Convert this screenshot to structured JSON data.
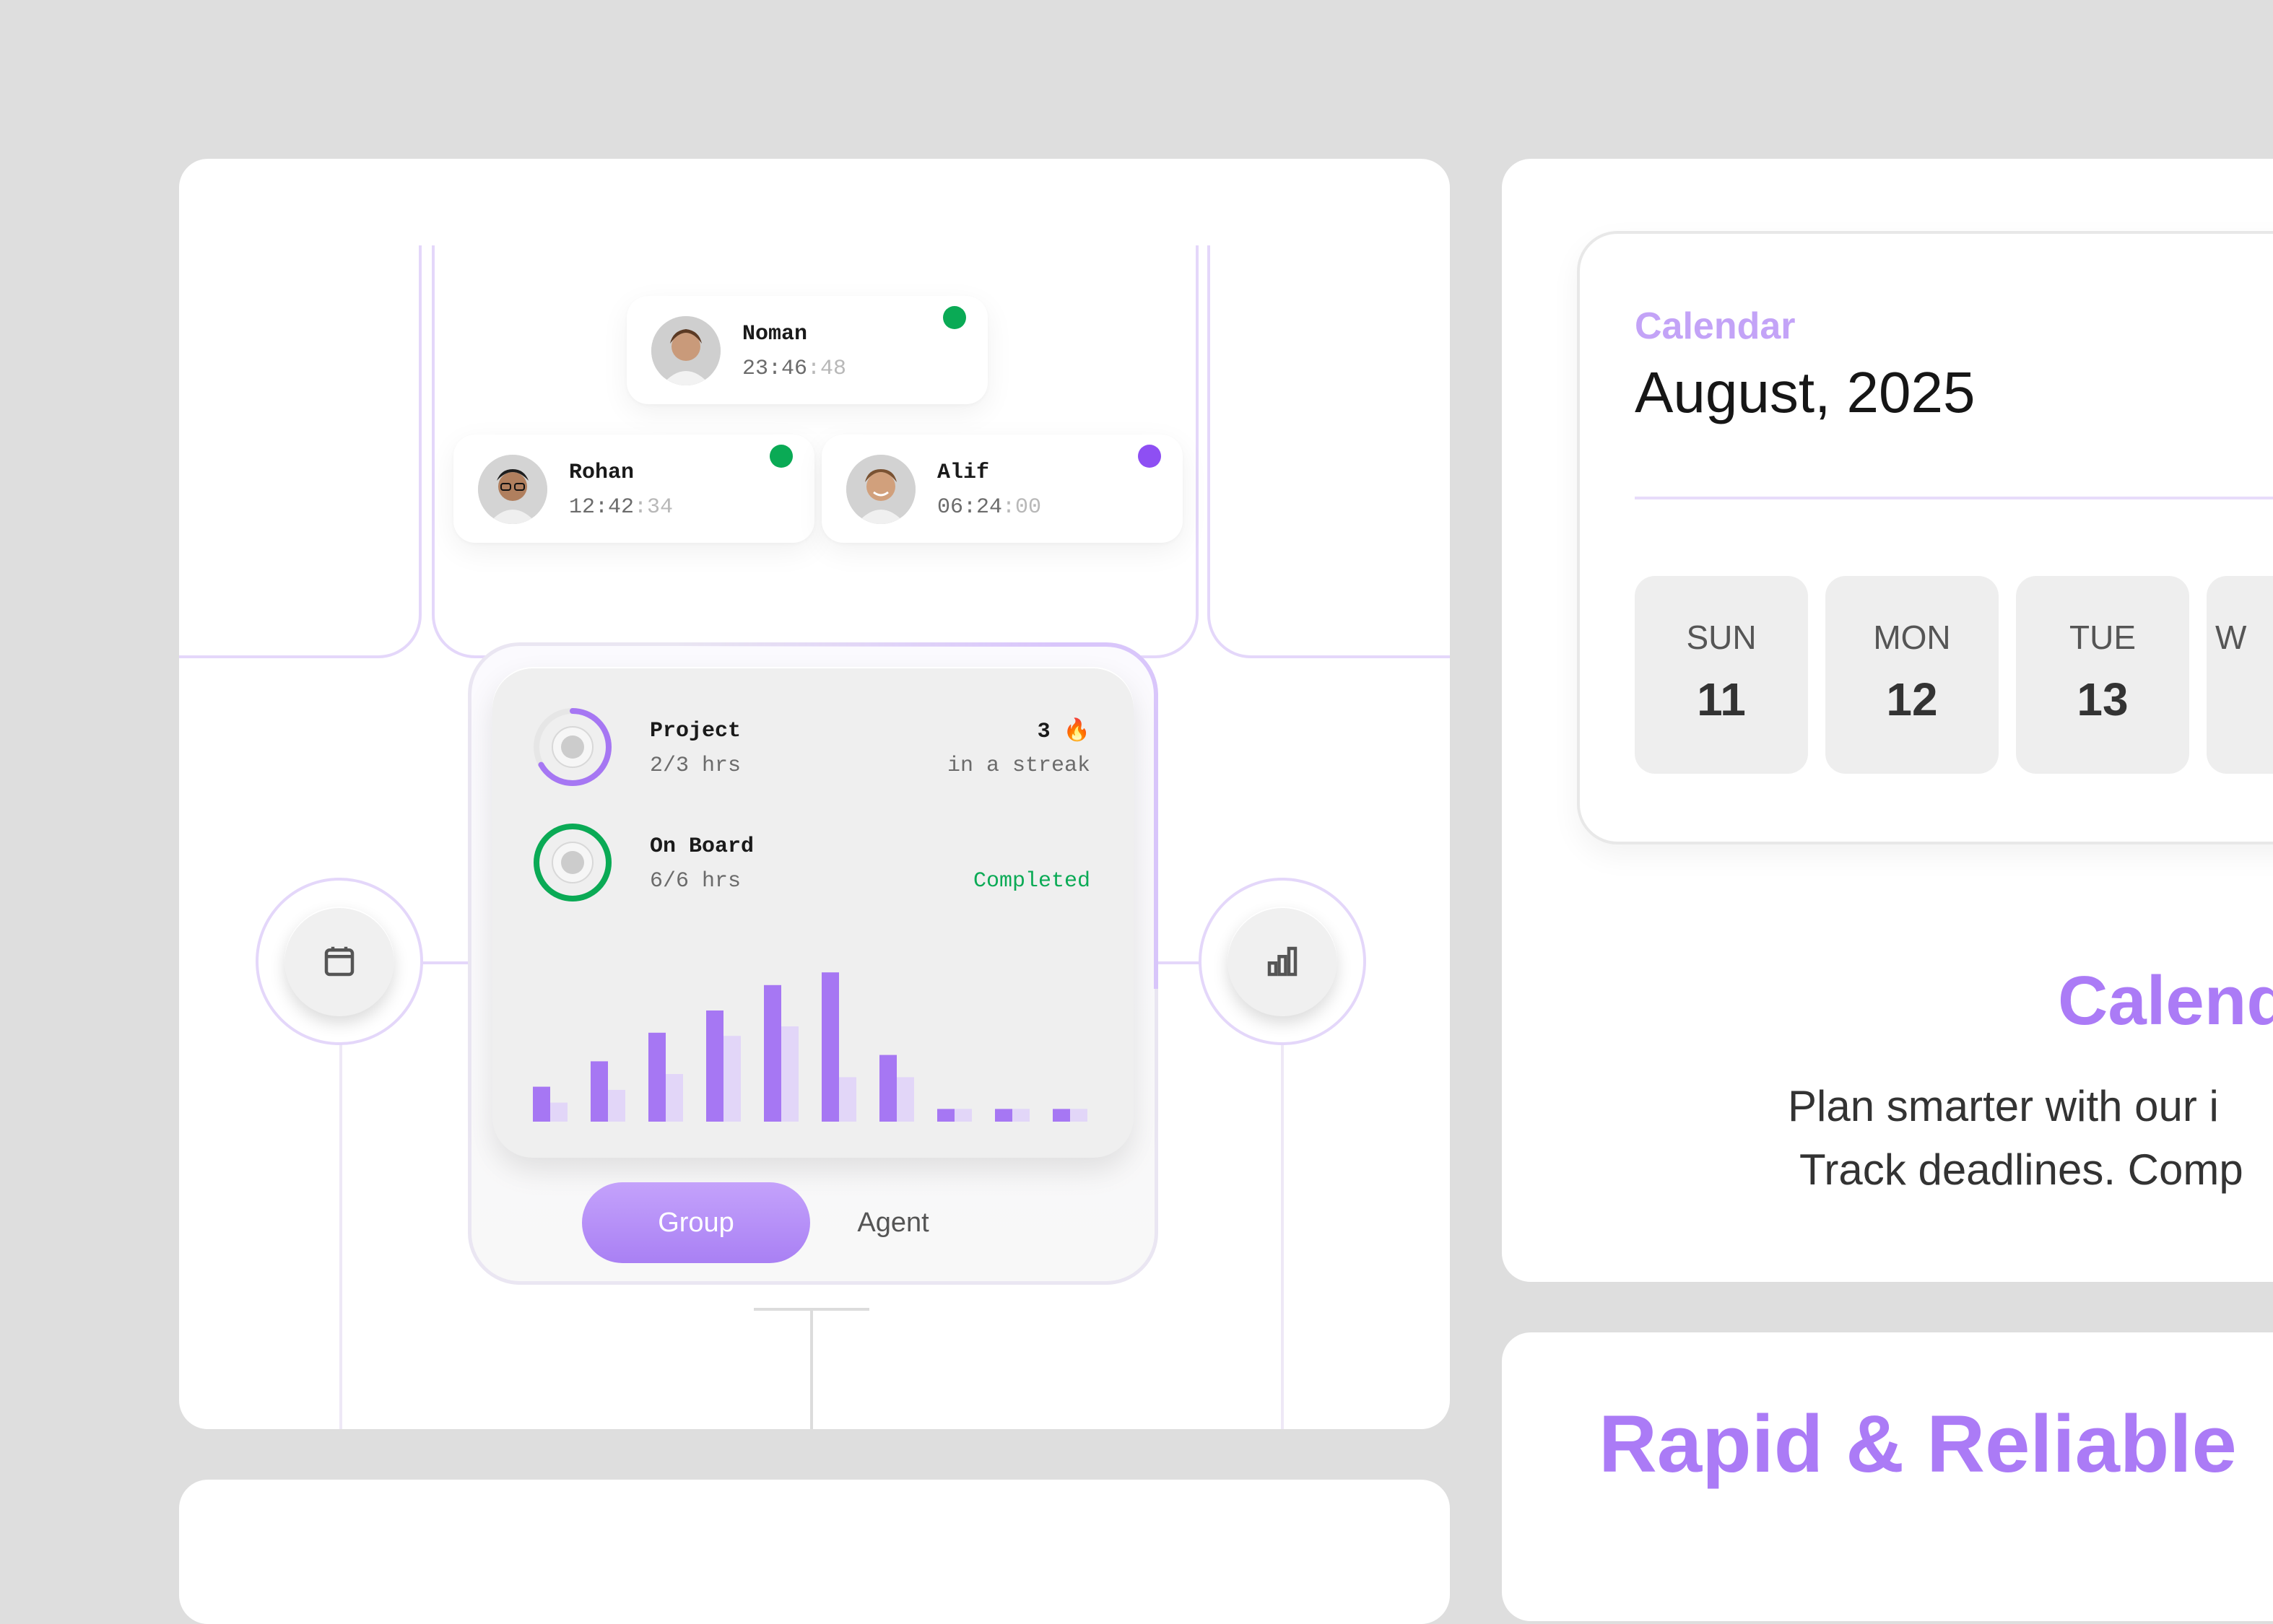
{
  "team_members": [
    {
      "name": "Noman",
      "time_main": "23:46",
      "time_seconds": ":48",
      "status_color": "#0aaa55"
    },
    {
      "name": "Rohan",
      "time_main": "12:42",
      "time_seconds": ":34",
      "status_color": "#0aaa55"
    },
    {
      "name": "Alif",
      "time_main": "06:24",
      "time_seconds": ":00",
      "status_color": "#8e4ff3"
    }
  ],
  "progress": {
    "project": {
      "title": "Project",
      "hours": "2/3 hrs",
      "fraction": 0.667,
      "streak_count": "3",
      "streak_icon": "🔥",
      "streak_label": "in a streak"
    },
    "onboard": {
      "title": "On Board",
      "hours": "6/6 hrs",
      "fraction": 1.0,
      "status": "Completed"
    }
  },
  "chart_data": {
    "type": "bar",
    "series": [
      {
        "values": [
          22,
          38,
          56,
          70,
          86,
          94,
          42,
          8,
          8,
          8
        ]
      },
      {
        "values": [
          12,
          20,
          30,
          54,
          60,
          28,
          28,
          8,
          8,
          8
        ]
      }
    ],
    "ylim": [
      0,
      100
    ],
    "colors": [
      "#a677f3",
      "#e2d6f8"
    ]
  },
  "tabs": {
    "group": "Group",
    "agent": "Agent"
  },
  "colors": {
    "accent": "#ab7bf6",
    "connector": "#e4d7fa",
    "success": "#0aaa55"
  },
  "calendar": {
    "label": "Calendar",
    "month": "August, 2025",
    "days": [
      {
        "name": "SUN",
        "num": "11"
      },
      {
        "name": "MON",
        "num": "12"
      },
      {
        "name": "TUE",
        "num": "13"
      },
      {
        "name": "W",
        "num": ""
      }
    ]
  },
  "feature": {
    "title": "Calend",
    "line1": "Plan smarter with our i",
    "line2": "Track deadlines. Comp"
  },
  "rapid": {
    "title": "Rapid & Reliable"
  }
}
